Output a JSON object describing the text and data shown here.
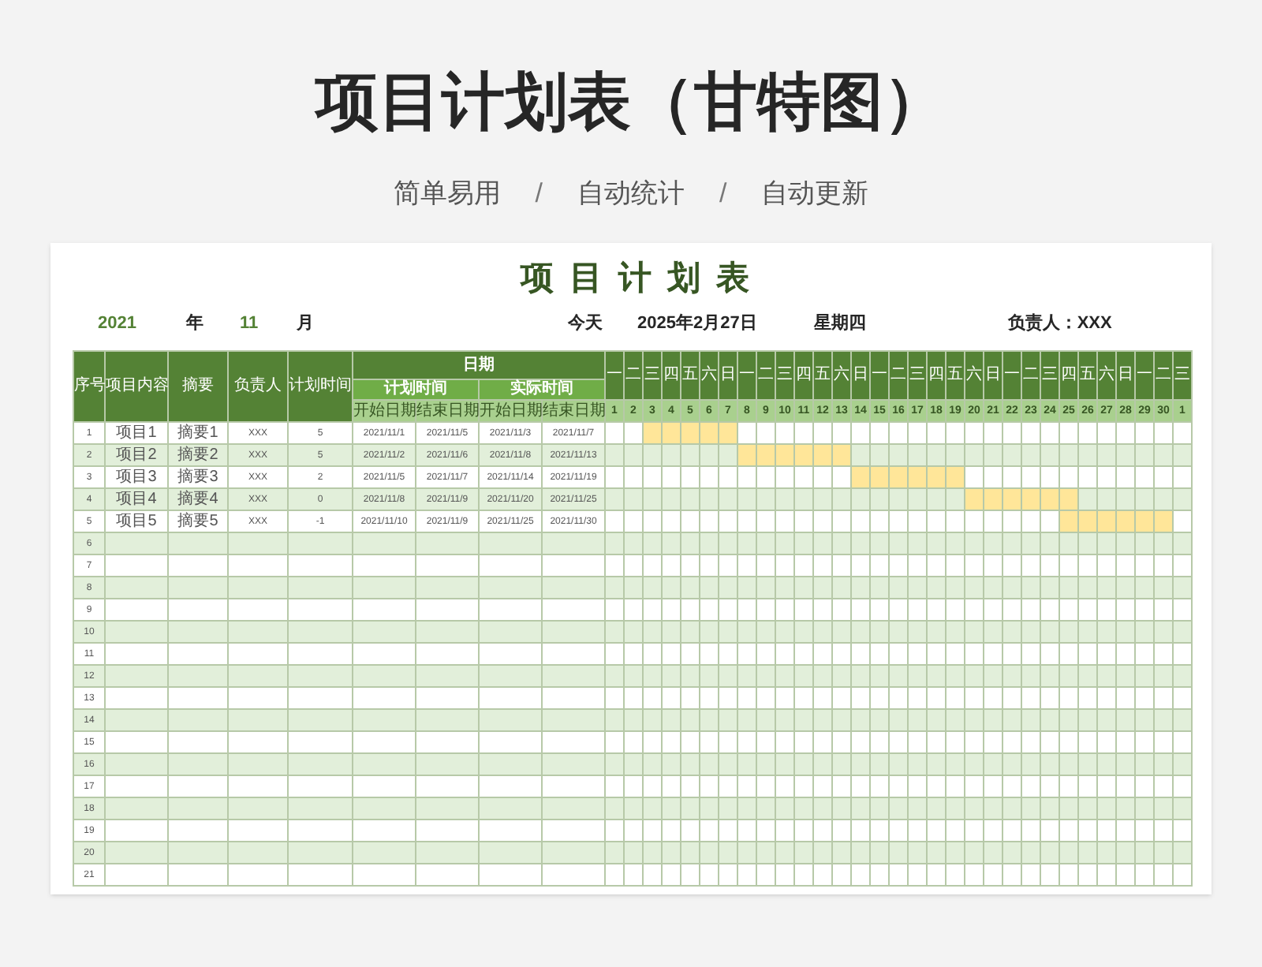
{
  "title": "项目计划表（甘特图）",
  "subtitle": [
    {
      "kind": "label",
      "text": "简单易用"
    },
    {
      "kind": "separator",
      "text": "/"
    },
    {
      "kind": "label",
      "text": "自动统计"
    },
    {
      "kind": "separator",
      "text": "/"
    },
    {
      "kind": "label",
      "text": "自动更新"
    }
  ],
  "sheet": {
    "title": "项目计划表",
    "year": "2021",
    "year_unit": "年",
    "month": "11",
    "month_unit": "月",
    "today_label": "今天",
    "today_date": "2025年2月27日",
    "weekday": "星期四",
    "owner": "负责人：XXX"
  },
  "table": {
    "columns": [
      "序号",
      "项目内容",
      "摘要",
      "负责人",
      "计划时间"
    ],
    "date_group": "日期",
    "plan_group": "计划时间",
    "actual_group": "实际时间",
    "sub_headers": [
      "开始日期",
      "结束日期",
      "开始日期",
      "结束日期"
    ],
    "days": [
      {
        "weekday": "一",
        "day": "1"
      },
      {
        "weekday": "二",
        "day": "2"
      },
      {
        "weekday": "三",
        "day": "3"
      },
      {
        "weekday": "四",
        "day": "4"
      },
      {
        "weekday": "五",
        "day": "5"
      },
      {
        "weekday": "六",
        "day": "6"
      },
      {
        "weekday": "日",
        "day": "7"
      },
      {
        "weekday": "一",
        "day": "8"
      },
      {
        "weekday": "二",
        "day": "9"
      },
      {
        "weekday": "三",
        "day": "10"
      },
      {
        "weekday": "四",
        "day": "11"
      },
      {
        "weekday": "五",
        "day": "12"
      },
      {
        "weekday": "六",
        "day": "13"
      },
      {
        "weekday": "日",
        "day": "14"
      },
      {
        "weekday": "一",
        "day": "15"
      },
      {
        "weekday": "二",
        "day": "16"
      },
      {
        "weekday": "三",
        "day": "17"
      },
      {
        "weekday": "四",
        "day": "18"
      },
      {
        "weekday": "五",
        "day": "19"
      },
      {
        "weekday": "六",
        "day": "20"
      },
      {
        "weekday": "日",
        "day": "21"
      },
      {
        "weekday": "一",
        "day": "22"
      },
      {
        "weekday": "二",
        "day": "23"
      },
      {
        "weekday": "三",
        "day": "24"
      },
      {
        "weekday": "四",
        "day": "25"
      },
      {
        "weekday": "五",
        "day": "26"
      },
      {
        "weekday": "六",
        "day": "27"
      },
      {
        "weekday": "日",
        "day": "28"
      },
      {
        "weekday": "一",
        "day": "29"
      },
      {
        "weekday": "二",
        "day": "30"
      },
      {
        "weekday": "三",
        "day": "1"
      }
    ],
    "rows": [
      {
        "cells": [
          "1",
          "项目1",
          "摘要1",
          "XXX",
          "5",
          "2021/11/1",
          "2021/11/5",
          "2021/11/3",
          "2021/11/7"
        ],
        "gantt": [
          false,
          false,
          true,
          true,
          true,
          true,
          true,
          false,
          false,
          false,
          false,
          false,
          false,
          false,
          false,
          false,
          false,
          false,
          false,
          false,
          false,
          false,
          false,
          false,
          false,
          false,
          false,
          false,
          false,
          false,
          false
        ]
      },
      {
        "cells": [
          "2",
          "项目2",
          "摘要2",
          "XXX",
          "5",
          "2021/11/2",
          "2021/11/6",
          "2021/11/8",
          "2021/11/13"
        ],
        "gantt": [
          false,
          false,
          false,
          false,
          false,
          false,
          false,
          true,
          true,
          true,
          true,
          true,
          true,
          false,
          false,
          false,
          false,
          false,
          false,
          false,
          false,
          false,
          false,
          false,
          false,
          false,
          false,
          false,
          false,
          false,
          false
        ]
      },
      {
        "cells": [
          "3",
          "项目3",
          "摘要3",
          "XXX",
          "2",
          "2021/11/5",
          "2021/11/7",
          "2021/11/14",
          "2021/11/19"
        ],
        "gantt": [
          false,
          false,
          false,
          false,
          false,
          false,
          false,
          false,
          false,
          false,
          false,
          false,
          false,
          true,
          true,
          true,
          true,
          true,
          true,
          false,
          false,
          false,
          false,
          false,
          false,
          false,
          false,
          false,
          false,
          false,
          false
        ]
      },
      {
        "cells": [
          "4",
          "项目4",
          "摘要4",
          "XXX",
          "0",
          "2021/11/8",
          "2021/11/9",
          "2021/11/20",
          "2021/11/25"
        ],
        "gantt": [
          false,
          false,
          false,
          false,
          false,
          false,
          false,
          false,
          false,
          false,
          false,
          false,
          false,
          false,
          false,
          false,
          false,
          false,
          false,
          true,
          true,
          true,
          true,
          true,
          true,
          false,
          false,
          false,
          false,
          false,
          false
        ]
      },
      {
        "cells": [
          "5",
          "项目5",
          "摘要5",
          "XXX",
          "-1",
          "2021/11/10",
          "2021/11/9",
          "2021/11/25",
          "2021/11/30"
        ],
        "gantt": [
          false,
          false,
          false,
          false,
          false,
          false,
          false,
          false,
          false,
          false,
          false,
          false,
          false,
          false,
          false,
          false,
          false,
          false,
          false,
          false,
          false,
          false,
          false,
          false,
          true,
          true,
          true,
          true,
          true,
          true,
          false
        ]
      },
      {
        "cells": [
          "6"
        ]
      },
      {
        "cells": [
          "7"
        ]
      },
      {
        "cells": [
          "8"
        ]
      },
      {
        "cells": [
          "9"
        ]
      },
      {
        "cells": [
          "10"
        ]
      },
      {
        "cells": [
          "11"
        ]
      },
      {
        "cells": [
          "12"
        ]
      },
      {
        "cells": [
          "13"
        ]
      },
      {
        "cells": [
          "14"
        ]
      },
      {
        "cells": [
          "15"
        ]
      },
      {
        "cells": [
          "16"
        ]
      },
      {
        "cells": [
          "17"
        ]
      },
      {
        "cells": [
          "18"
        ]
      },
      {
        "cells": [
          "19"
        ]
      },
      {
        "cells": [
          "20"
        ]
      },
      {
        "cells": [
          "21"
        ]
      }
    ]
  }
}
